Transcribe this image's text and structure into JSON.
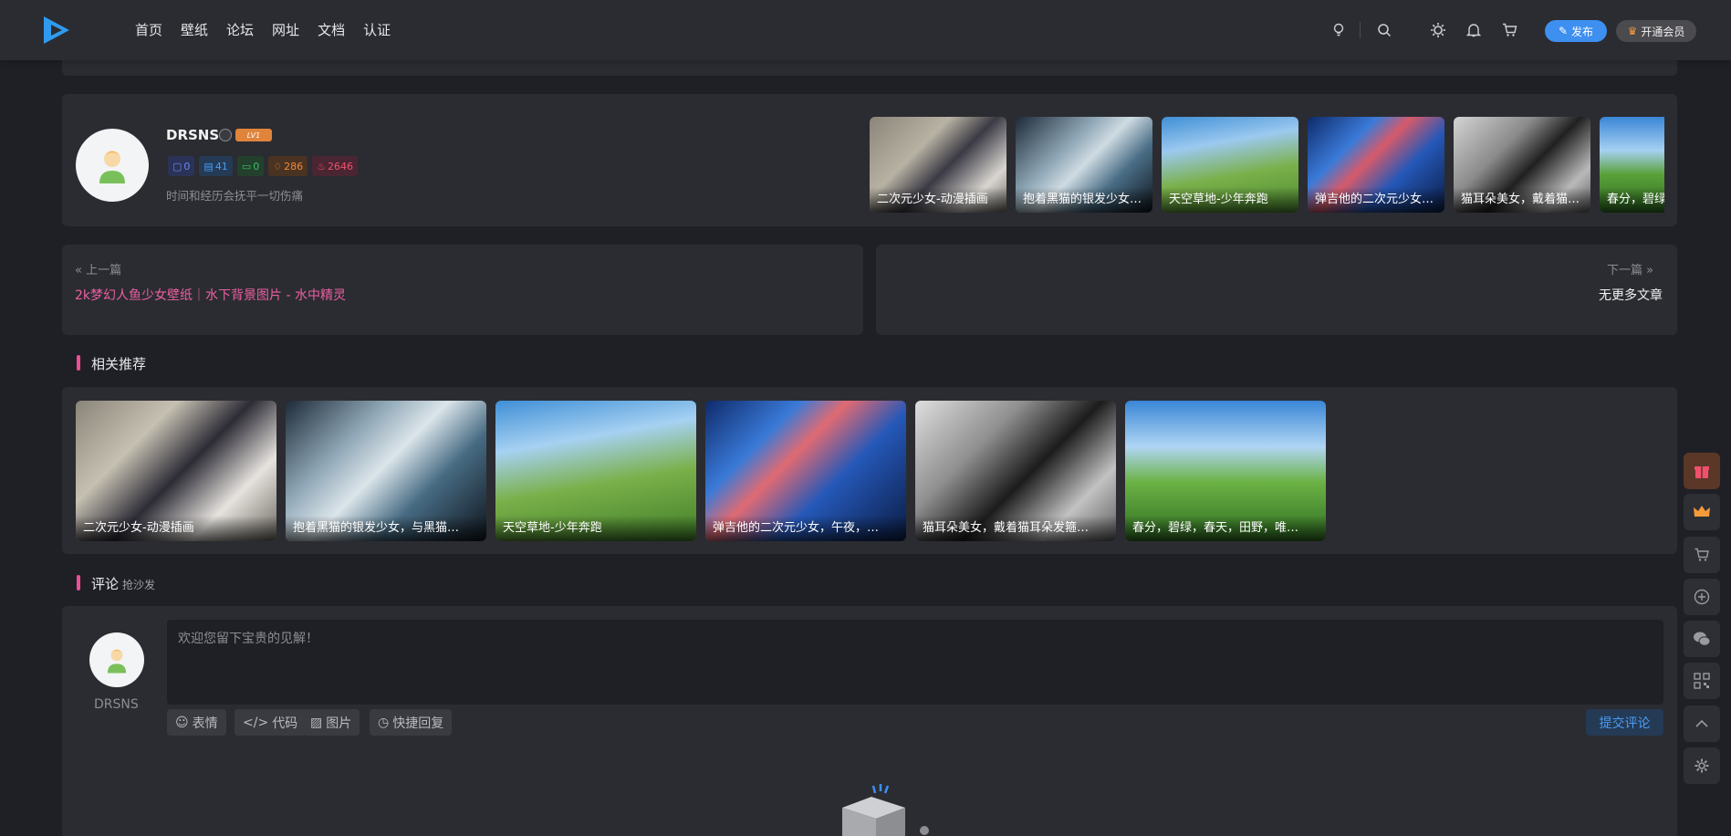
{
  "header": {
    "nav": [
      "首页",
      "壁纸",
      "论坛",
      "网址",
      "文档",
      "认证"
    ],
    "publish_label": "发布",
    "vip_label": "开通会员"
  },
  "author": {
    "name": "DRSNS",
    "level": "LV1",
    "stats": [
      "0",
      "41",
      "0",
      "286",
      "2646"
    ],
    "signature": "时间和经历会抚平一切伤痛",
    "thumbs": [
      "二次元少女-动漫插画",
      "抱着黑猫的银发少女，与黑猫…",
      "天空草地-少年奔跑",
      "弹吉他的二次元少女，午夜，…",
      "猫耳朵美女，戴着猫耳朵发箍…",
      "春分，碧绿，春天，田野，唯…"
    ]
  },
  "prev_next": {
    "prev_label": "上一篇",
    "prev_title": "2k梦幻人鱼少女壁纸｜水下背景图片 - 水中精灵",
    "next_label": "下一篇",
    "next_title": "无更多文章"
  },
  "related": {
    "title": "相关推荐",
    "items": [
      "二次元少女-动漫插画",
      "抱着黑猫的银发少女，与黑猫…",
      "天空草地-少年奔跑",
      "弹吉他的二次元少女，午夜，…",
      "猫耳朵美女，戴着猫耳朵发箍…",
      "春分，碧绿，春天，田野，唯…"
    ]
  },
  "comment": {
    "title": "评论",
    "subtitle": "抢沙发",
    "user": "DRSNS",
    "placeholder": "欢迎您留下宝贵的见解！",
    "tools": [
      "表情",
      "代码",
      "图片",
      "快捷回复"
    ],
    "submit_label": "提交评论"
  }
}
